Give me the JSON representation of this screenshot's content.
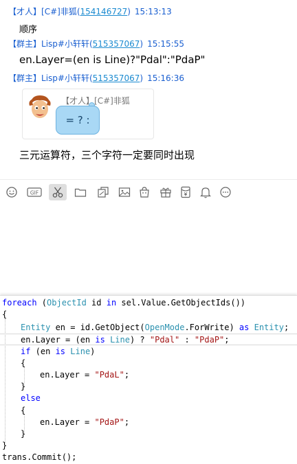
{
  "messages": [
    {
      "role": "【才人】",
      "name": "[C#]非狐",
      "qq": "154146727",
      "time": "15:13:13",
      "text": "顺序"
    },
    {
      "role": "【群主】",
      "name": "Lisp#小轩轩",
      "qq": "515357067",
      "time": "15:15:55",
      "text": "en.Layer=(en is Line)?\"Pdal\":\"PdaP\""
    },
    {
      "role": "【群主】",
      "name": "Lisp#小轩轩",
      "qq": "515357067",
      "time": "15:16:36",
      "text": "三元运算符，三个字符一定要同时出现",
      "quote": {
        "role": "【才人】",
        "name": "[C#]非狐",
        "text": "= ? :"
      }
    }
  ],
  "toolbar": {
    "icons": [
      "emoji-icon",
      "gif-icon",
      "scissors-icon",
      "folder-icon",
      "screenshot-icon",
      "image-icon",
      "shopping-bag-icon",
      "gift-icon",
      "red-packet-icon",
      "bell-icon",
      "more-icon"
    ],
    "gif_label": "GIF",
    "active": "scissors-icon"
  },
  "code": {
    "l1": {
      "kw1": "foreach",
      "p1": " (",
      "ty1": "ObjectId",
      "p2": " id ",
      "kw2": "in",
      "p3": " sel.Value.GetObjectIds())"
    },
    "l2": {
      "p1": "{"
    },
    "l3": {
      "ty1": "Entity",
      "p1": " en = id.GetObject(",
      "ty2": "OpenMode",
      "p2": ".ForWrite) ",
      "kw1": "as",
      "p3": " ",
      "ty3": "Entity",
      "p4": ";"
    },
    "l4": {
      "p1": "en.Layer = (en ",
      "kw1": "is",
      "p2": " ",
      "ty1": "Line",
      "p3": ") ? ",
      "st1": "\"Pdal\"",
      "p4": " : ",
      "st2": "\"PdaP\"",
      "p5": ";"
    },
    "l5": {
      "kw1": "if",
      "p1": " (en ",
      "kw2": "is",
      "p2": " ",
      "ty1": "Line",
      "p3": ")"
    },
    "l6": {
      "p1": "{"
    },
    "l7": {
      "p1": "en.Layer = ",
      "st1": "\"PdaL\"",
      "p2": ";"
    },
    "l8": {
      "p1": "}"
    },
    "l9": {
      "kw1": "else"
    },
    "l10": {
      "p1": "{"
    },
    "l11": {
      "p1": "en.Layer = ",
      "st1": "\"PdaP\"",
      "p2": ";"
    },
    "l12": {
      "p1": "}"
    },
    "l13": {
      "p1": "}"
    },
    "l14": {
      "p1": "trans.Commit();"
    }
  },
  "colors": {
    "header_blue": "#1a5fd0",
    "bubble_fill": "#a9d8f5",
    "keyword": "#0000ff",
    "type": "#2b91af",
    "string": "#a31515"
  }
}
